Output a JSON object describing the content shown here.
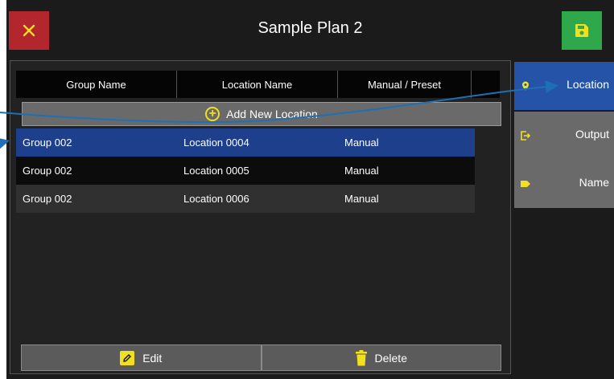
{
  "header": {
    "title": "Sample Plan 2"
  },
  "toolbar": {
    "close_icon": "close-icon",
    "save_icon": "save-icon"
  },
  "table": {
    "columns": [
      "Group Name",
      "Location Name",
      "Manual / Preset"
    ],
    "add_label": "Add New Location",
    "rows": [
      {
        "group": "Group 002",
        "location": "Location 0004",
        "mode": "Manual",
        "selected": true
      },
      {
        "group": "Group 002",
        "location": "Location 0005",
        "mode": "Manual",
        "selected": false
      },
      {
        "group": "Group 002",
        "location": "Location 0006",
        "mode": "Manual",
        "selected": false
      }
    ]
  },
  "footer": {
    "edit_label": "Edit",
    "delete_label": "Delete"
  },
  "sidebar": {
    "items": [
      {
        "label": "Location",
        "icon": "location-pin-icon",
        "active": true
      },
      {
        "label": "Output",
        "icon": "output-icon",
        "active": false
      },
      {
        "label": "Name",
        "icon": "tag-icon",
        "active": false
      }
    ]
  },
  "colors": {
    "close": "#b3262d",
    "save": "#2ea84a",
    "accent": "#2553a8",
    "icon_yellow": "#f0e020",
    "callout": "#1f6fb5"
  }
}
